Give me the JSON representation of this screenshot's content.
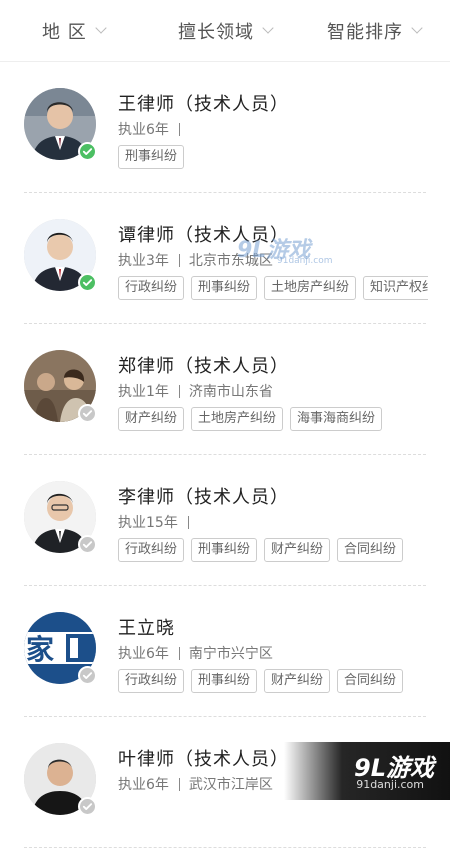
{
  "filters": [
    {
      "label": "地 区"
    },
    {
      "label": "擅长领域"
    },
    {
      "label": "智能排序"
    }
  ],
  "lawyers": [
    {
      "name": "王律师（技术人员）",
      "years": "执业6年",
      "location": "",
      "verified": true,
      "tags": [
        "刑事纠纷"
      ]
    },
    {
      "name": "谭律师（技术人员）",
      "years": "执业3年",
      "location": "北京市东城区",
      "verified": true,
      "tags": [
        "行政纠纷",
        "刑事纠纷",
        "土地房产纠纷",
        "知识产权纠纷"
      ]
    },
    {
      "name": "郑律师（技术人员）",
      "years": "执业1年",
      "location": "济南市山东省",
      "verified": false,
      "tags": [
        "财产纠纷",
        "土地房产纠纷",
        "海事海商纠纷"
      ]
    },
    {
      "name": "李律师（技术人员）",
      "years": "执业15年",
      "location": "",
      "verified": false,
      "tags": [
        "行政纠纷",
        "刑事纠纷",
        "财产纠纷",
        "合同纠纷"
      ]
    },
    {
      "name": "王立晓",
      "years": "执业6年",
      "location": "南宁市兴宁区",
      "verified": false,
      "tags": [
        "行政纠纷",
        "刑事纠纷",
        "财产纠纷",
        "合同纠纷"
      ]
    },
    {
      "name": "叶律师（技术人员）",
      "years": "执业6年",
      "location": "武汉市江岸区",
      "verified": false,
      "tags": []
    }
  ],
  "watermark": {
    "logo": "9L游戏",
    "url": "91danji.com"
  },
  "colors": {
    "verified": "#4cbf63",
    "unverified": "#c8c8c8"
  }
}
